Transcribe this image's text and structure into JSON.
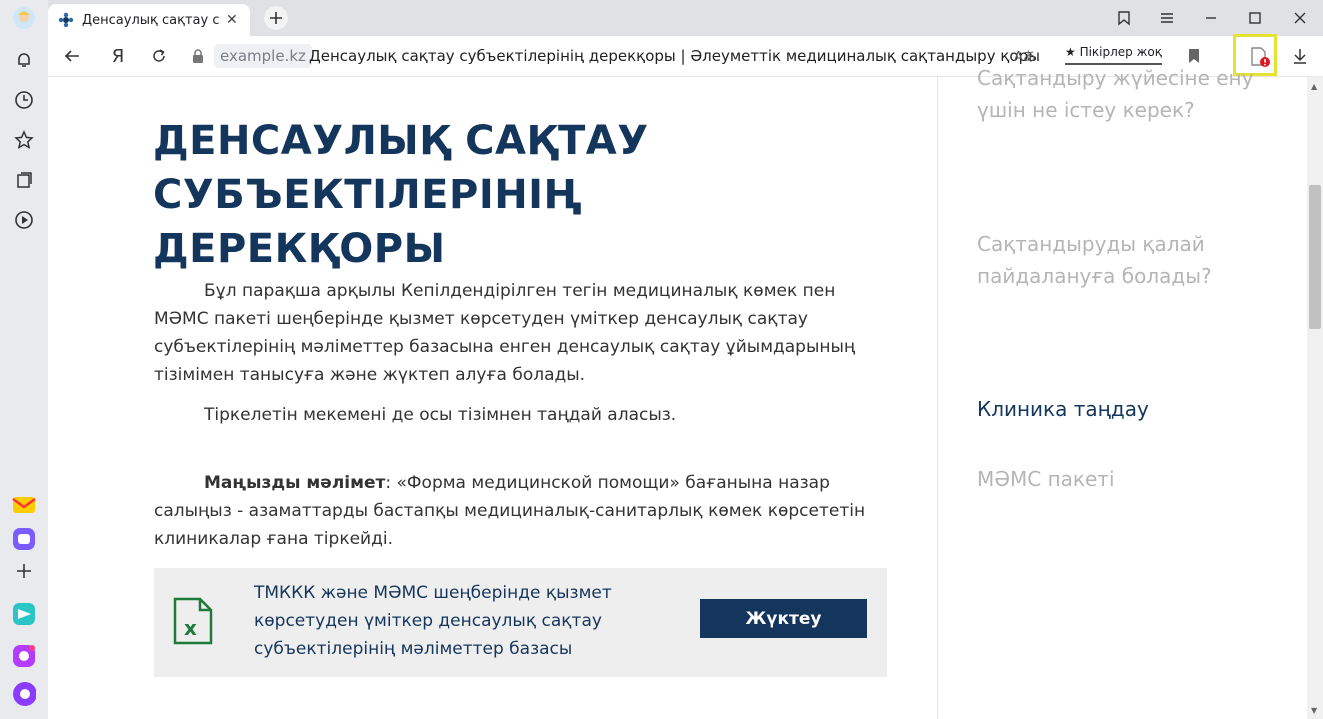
{
  "browser": {
    "tab_title": "Денсаулық сақтау субъ",
    "domain": "example.kz",
    "page_title": "Денсаулық сақтау субъектілерінің дерекқоры | Әлеуметтік медициналық сақтандыру қоры",
    "reviews_label": "★ Пікірлер жоқ",
    "icons": [
      "bell-icon",
      "clock-icon",
      "star-icon",
      "collections-icon",
      "play-icon",
      "mail-icon",
      "messenger-icon",
      "plus-icon",
      "send-icon",
      "music-icon",
      "alice-icon"
    ]
  },
  "content": {
    "heading": "ДЕНСАУЛЫҚ САҚТАУ СУБЪЕКТІЛЕРІНІҢ ДЕРЕКҚОРЫ",
    "paragraph1": "Бұл парақша арқылы Кепілдендірілген тегін медициналық көмек пен МӘМС пакеті шеңберінде қызмет көрсетуден үміткер денсаулық сақтау субъектілерінің мәліметтер базасына енген денсаулық сақтау ұйымдарының тізімімен танысуға және жүктеп алуға болады.",
    "paragraph2": "Тіркелетін мекемені де осы тізімнен таңдай аласыз.",
    "important_label": "Маңызды мәлімет",
    "important_text": ": «Форма медицинской помощи» бағанына назар салыңыз - азаматтарды бастапқы медициналық-санитарлық көмек көрсететін клиникалар ғана тіркейді.",
    "download_text": "ТМККК және МӘМС шеңберінде қызмет көрсетуден үміткер денсаулық сақтау субъектілерінің мәліметтер базасы",
    "download_button": "Жүктеу"
  },
  "right_nav": {
    "item1": "Сақтандыру жүйесіне ену үшін не істеу керек?",
    "item2": "Сақтандыруды қалай пайдалануға болады?",
    "item3": "Клиника таңдау",
    "item4": "МӘМС пакеті"
  },
  "colors": {
    "accent": "#14365c",
    "muted": "#b5b5b5",
    "excel_green": "#1e7a3a"
  }
}
